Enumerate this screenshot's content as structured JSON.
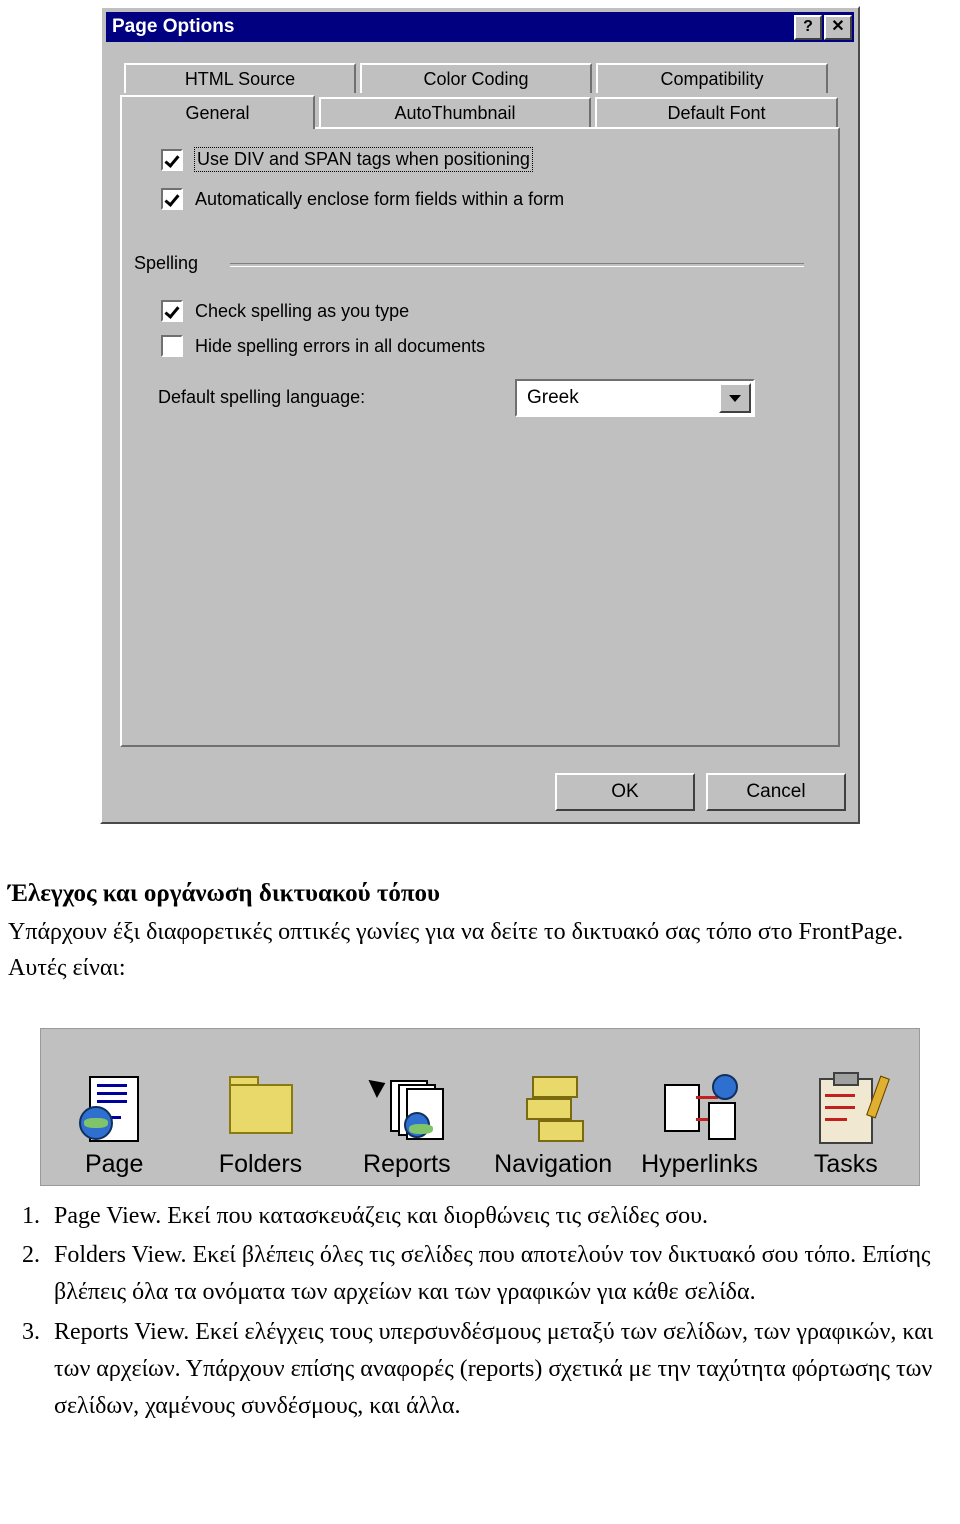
{
  "dialog": {
    "title": "Page Options",
    "help_button": "?",
    "close_button": "✕",
    "tabs_row1": [
      {
        "label": "HTML Source",
        "active": false
      },
      {
        "label": "Color Coding",
        "active": false
      },
      {
        "label": "Compatibility",
        "active": false
      }
    ],
    "tabs_row2": [
      {
        "label": "General",
        "active": true
      },
      {
        "label": "AutoThumbnail",
        "active": false
      },
      {
        "label": "Default Font",
        "active": false
      }
    ],
    "options": [
      {
        "label": "Use DIV and SPAN tags when positioning",
        "checked": true,
        "focused": true
      },
      {
        "label": "Automatically enclose form fields within a form",
        "checked": true,
        "focused": false
      }
    ],
    "spelling": {
      "group_title": "Spelling",
      "options": [
        {
          "label": "Check spelling as you type",
          "checked": true
        },
        {
          "label": "Hide spelling errors in all documents",
          "checked": false
        }
      ],
      "language_label": "Default spelling language:",
      "language_value": "Greek"
    },
    "buttons": {
      "ok": "OK",
      "cancel": "Cancel"
    }
  },
  "document": {
    "heading": "Έλεγχος και οργάνωση δικτυακού τόπου",
    "paragraph": "Υπάρχουν έξι διαφορετικές οπτικές γωνίες για να δείτε το δικτυακό σας τόπο στο FrontPage. Αυτές είναι:",
    "views_bar": [
      {
        "label": "Page",
        "icon": "page-view-icon"
      },
      {
        "label": "Folders",
        "icon": "folders-view-icon"
      },
      {
        "label": "Reports",
        "icon": "reports-view-icon"
      },
      {
        "label": "Navigation",
        "icon": "navigation-view-icon"
      },
      {
        "label": "Hyperlinks",
        "icon": "hyperlinks-view-icon"
      },
      {
        "label": "Tasks",
        "icon": "tasks-view-icon"
      }
    ],
    "list": [
      {
        "num": "1.",
        "lead": "Page View.",
        "text": " Εκεί που κατασκευάζεις και διορθώνεις τις σελίδες σου."
      },
      {
        "num": "2.",
        "lead": "Folders View.",
        "text": " Εκεί βλέπεις όλες τις σελίδες που αποτελούν τον δικτυακό σου τόπο. Επίσης βλέπεις όλα τα ονόματα των αρχείων και των γραφικών για κάθε σελίδα."
      },
      {
        "num": "3.",
        "lead": "Reports View.",
        "text": " Εκεί ελέγχεις τους υπερσυνδέσμους μεταξύ των σελίδων, των γραφικών, και των αρχείων. Υπάρχουν επίσης αναφορές (reports) σχετικά με την ταχύτητα φόρτωσης των σελίδων, χαμένους συνδέσμους, και άλλα."
      }
    ]
  },
  "colors": {
    "dialog_face": "#c0c0c0",
    "titlebar": "#000080",
    "field_bg": "#ffffff"
  }
}
